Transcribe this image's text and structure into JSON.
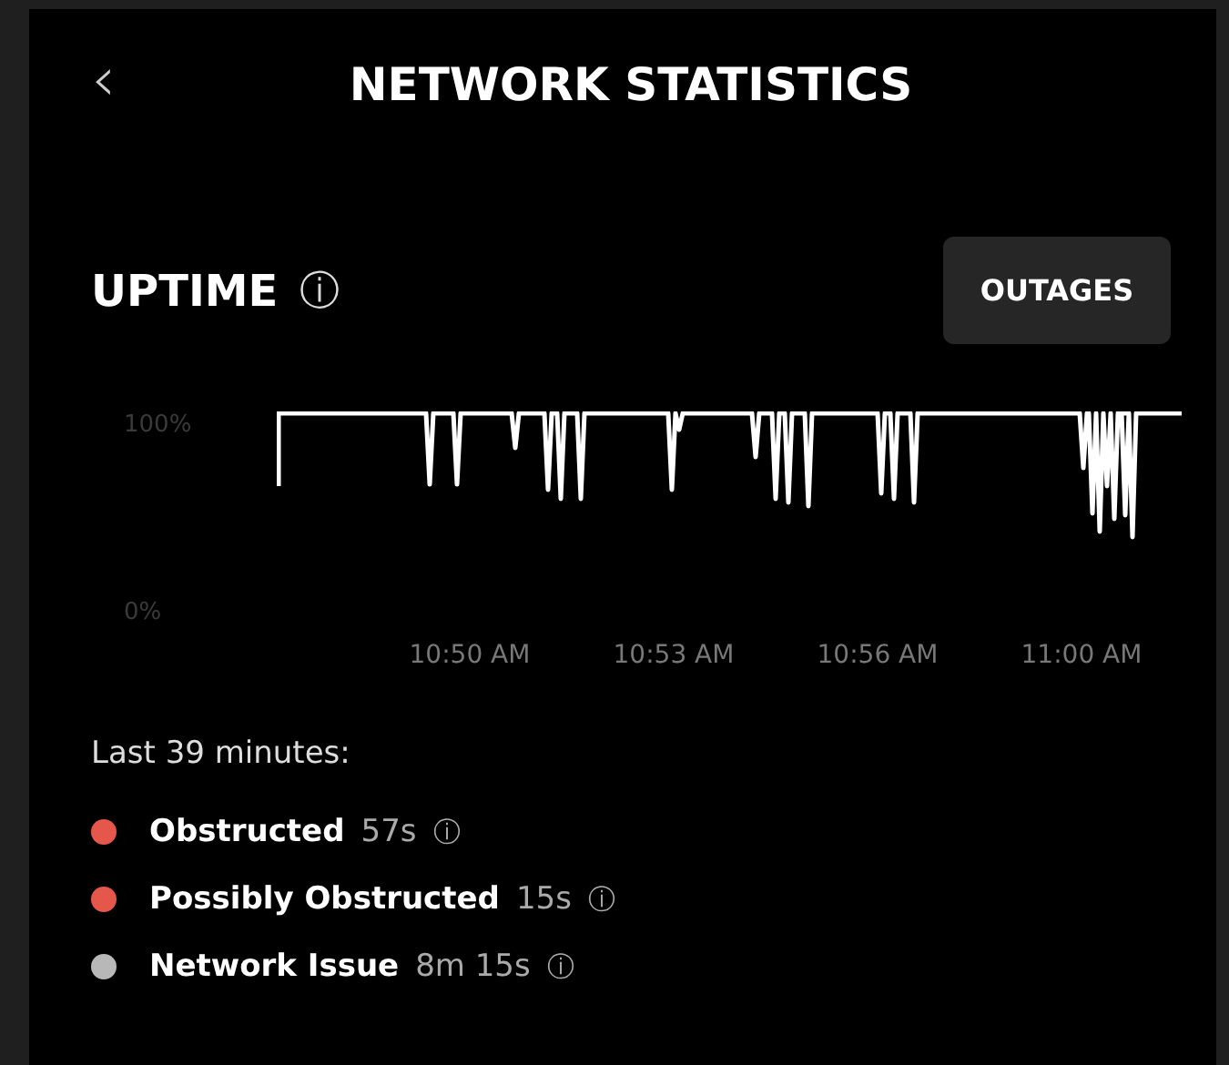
{
  "header": {
    "back": "‹",
    "title": "NETWORK STATISTICS"
  },
  "section": {
    "title": "UPTIME",
    "info": "ⓘ",
    "button": "OUTAGES"
  },
  "chart": {
    "y_labels": [
      "100%",
      "0%"
    ],
    "x_labels": [
      "10:50 AM",
      "10:53 AM",
      "10:56 AM",
      "11:00 AM"
    ]
  },
  "summary": {
    "caption": "Last 39 minutes:",
    "items": [
      {
        "label": "Obstructed",
        "value": "57s",
        "info": "ⓘ",
        "color": "#e5574b"
      },
      {
        "label": "Possibly Obstructed",
        "value": "15s",
        "info": "ⓘ",
        "color": "#e5574b"
      },
      {
        "label": "Network Issue",
        "value": "8m 15s",
        "info": "ⓘ",
        "color": "#b8b8b8"
      }
    ]
  }
}
